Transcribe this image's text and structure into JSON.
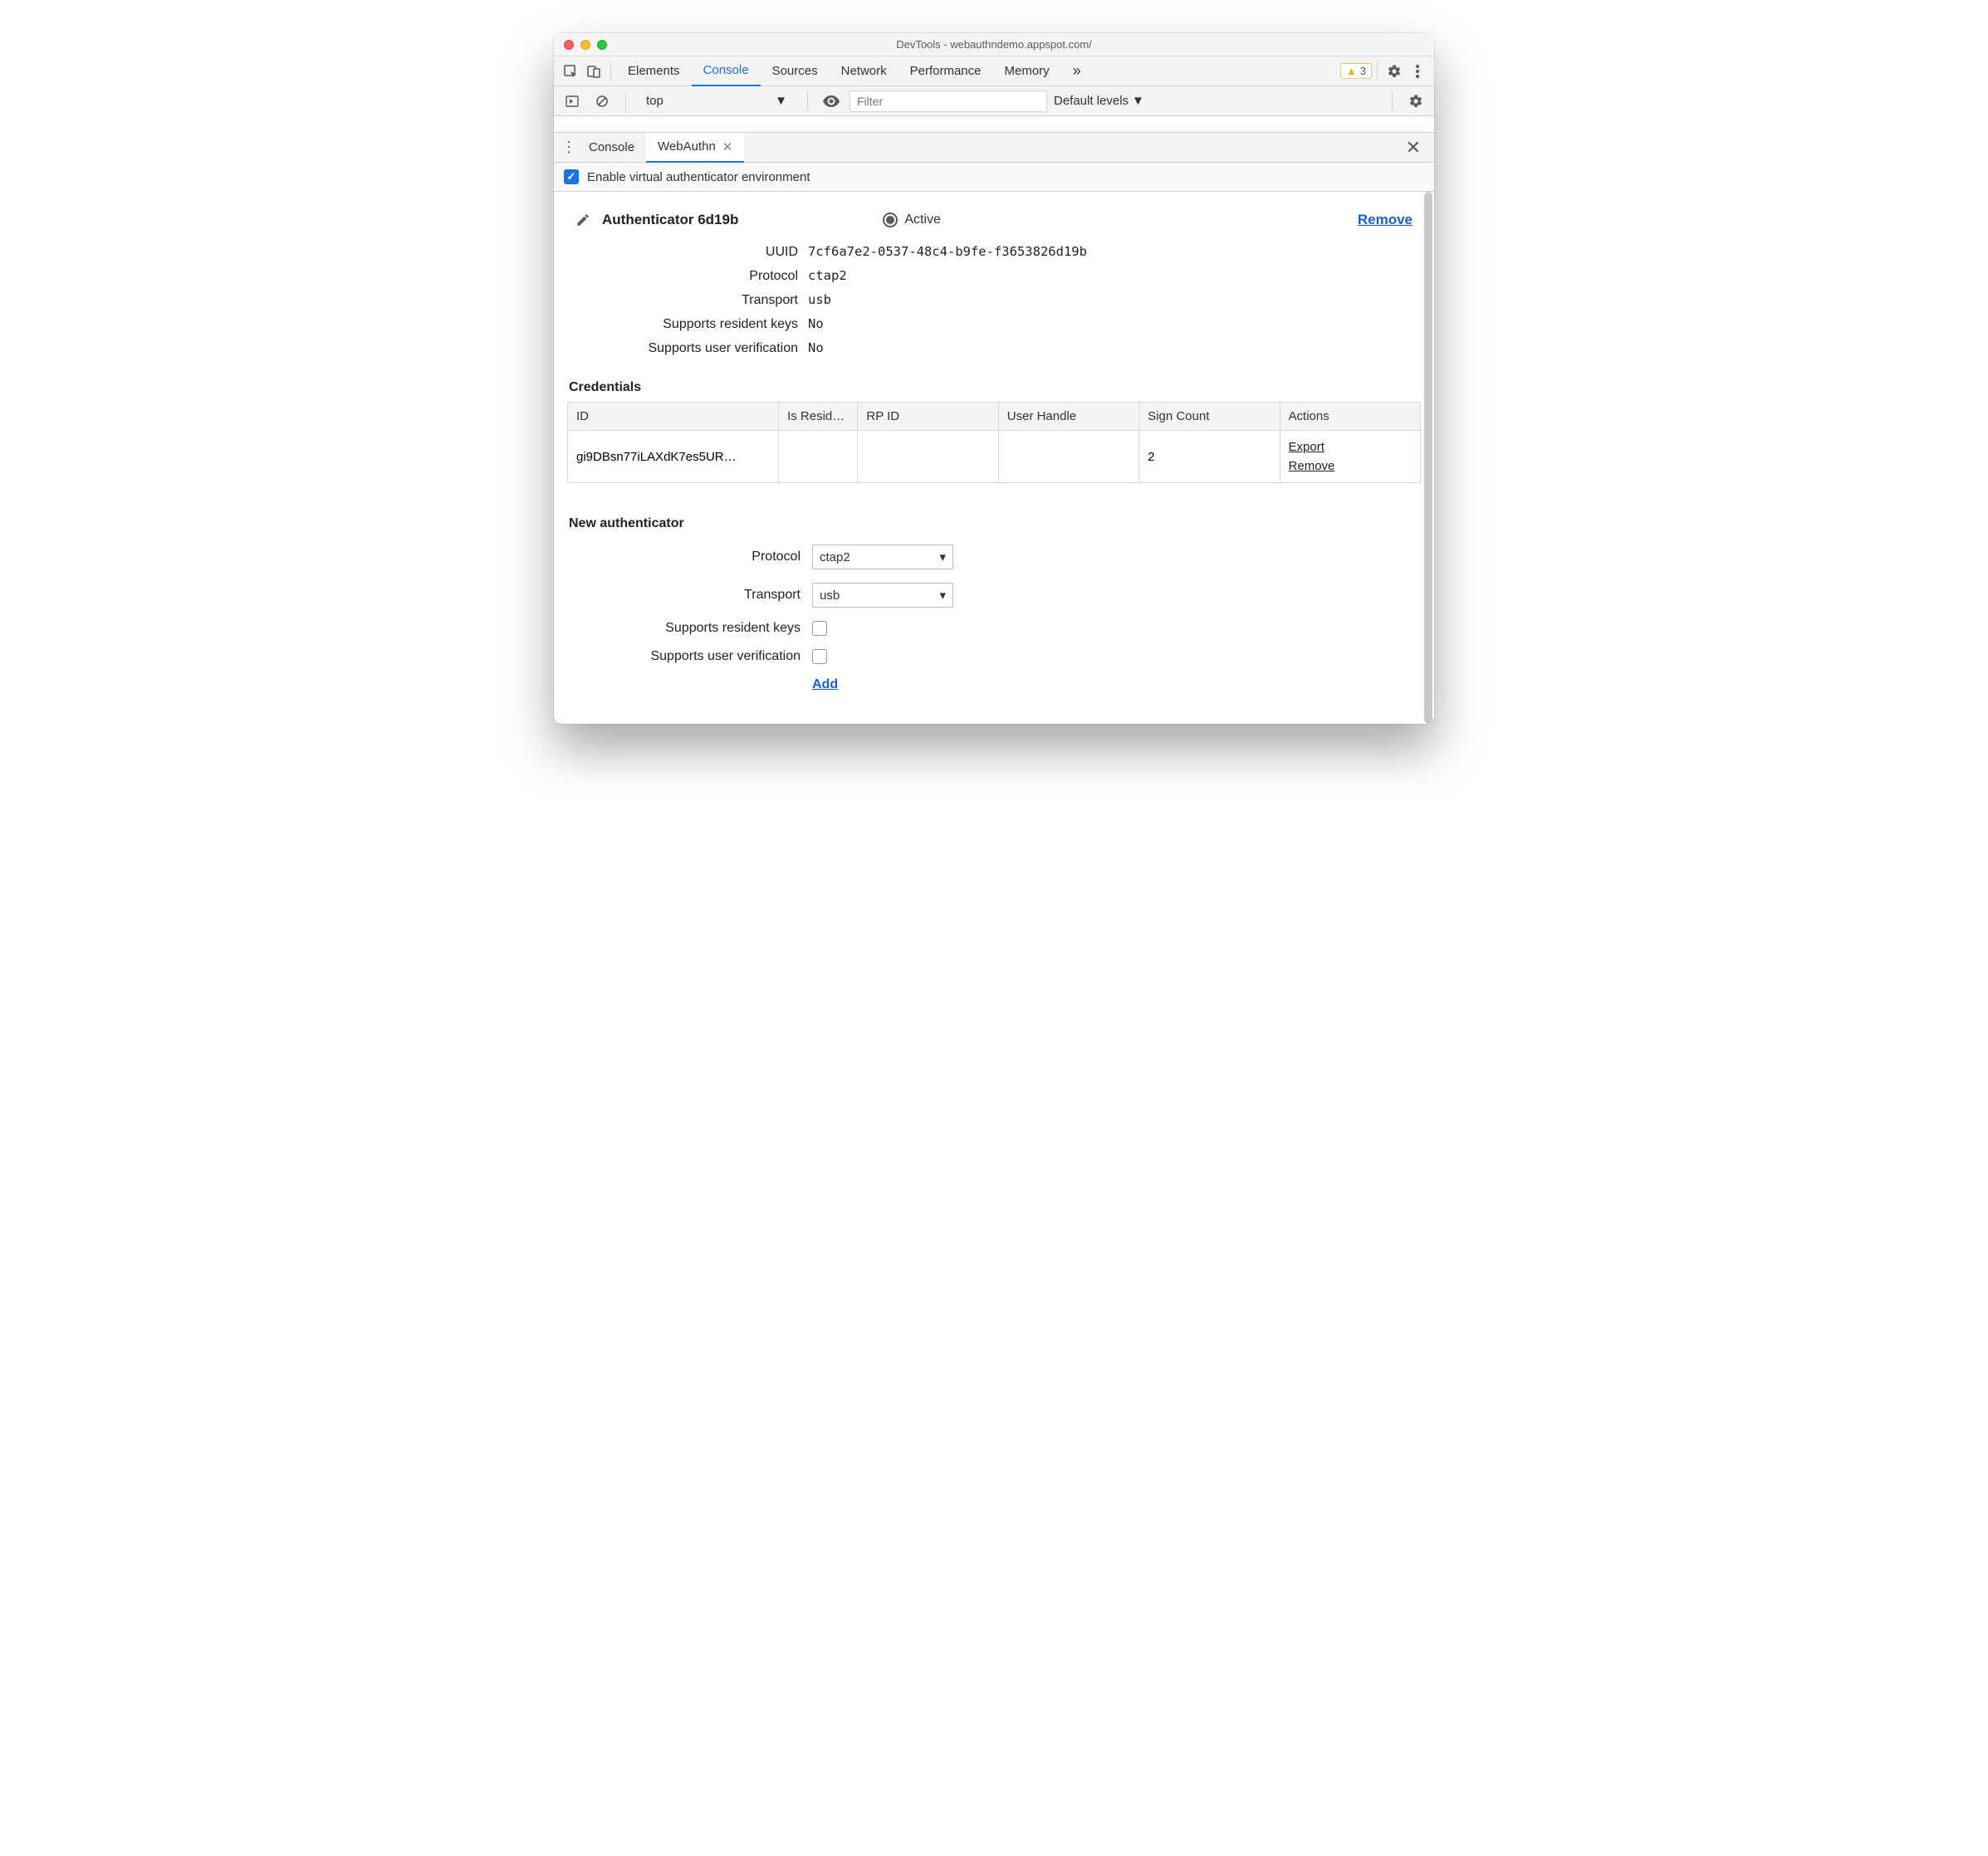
{
  "window": {
    "title": "DevTools - webauthndemo.appspot.com/"
  },
  "main_tabs": {
    "items": [
      "Elements",
      "Console",
      "Sources",
      "Network",
      "Performance",
      "Memory"
    ],
    "active_index": 1,
    "overflow": "»"
  },
  "warnings": {
    "count": "3"
  },
  "console_toolbar": {
    "context": "top",
    "filter_placeholder": "Filter",
    "levels": "Default levels"
  },
  "drawer": {
    "tabs": [
      "Console",
      "WebAuthn"
    ],
    "active_index": 1
  },
  "enable": {
    "label": "Enable virtual authenticator environment",
    "checked": true
  },
  "authenticator": {
    "name": "Authenticator 6d19b",
    "active_label": "Active",
    "remove_label": "Remove",
    "props": {
      "uuid_label": "UUID",
      "uuid": "7cf6a7e2-0537-48c4-b9fe-f3653826d19b",
      "protocol_label": "Protocol",
      "protocol": "ctap2",
      "transport_label": "Transport",
      "transport": "usb",
      "resident_label": "Supports resident keys",
      "resident": "No",
      "userverif_label": "Supports user verification",
      "userverif": "No"
    }
  },
  "credentials": {
    "title": "Credentials",
    "headers": [
      "ID",
      "Is Resid…",
      "RP ID",
      "User Handle",
      "Sign Count",
      "Actions"
    ],
    "row": {
      "id": "gi9DBsn77iLAXdK7es5UR…",
      "is_resident": "",
      "rp_id": "",
      "user_handle": "",
      "sign_count": "2",
      "actions": {
        "export": "Export",
        "remove": "Remove"
      }
    }
  },
  "new_auth": {
    "title": "New authenticator",
    "protocol_label": "Protocol",
    "protocol_value": "ctap2",
    "transport_label": "Transport",
    "transport_value": "usb",
    "resident_label": "Supports resident keys",
    "userverif_label": "Supports user verification",
    "add_label": "Add"
  }
}
